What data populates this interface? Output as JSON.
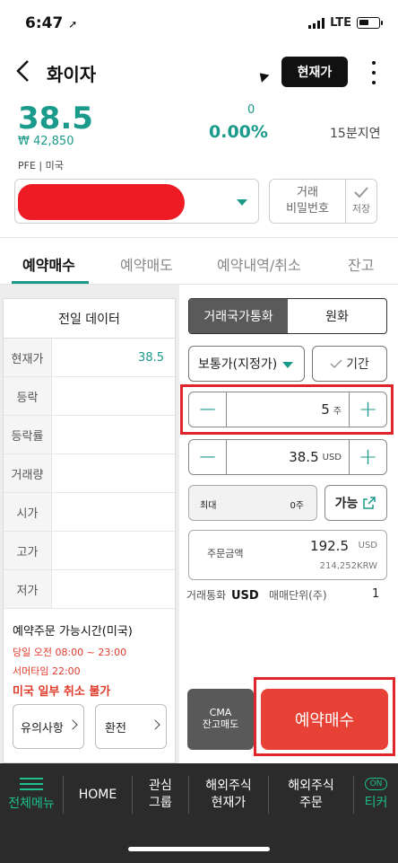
{
  "status": {
    "time": "6:47",
    "network": "LTE"
  },
  "header": {
    "title": "화이자",
    "current_price_button": "현재가"
  },
  "quote": {
    "price": "38.5",
    "krw_price": "₩ 42,850",
    "change": "0",
    "change_pct": "0.00%",
    "delay": "15분지연",
    "ticker": "PFE | 미국"
  },
  "account": {
    "password_label_1": "거래",
    "password_label_2": "비밀번호",
    "save_label": "저장"
  },
  "tabs": [
    "예약매수",
    "예약매도",
    "예약내역/취소",
    "잔고"
  ],
  "prev_day": {
    "title": "전일 데이터",
    "rows": [
      {
        "label": "현재가",
        "value": "38.5"
      },
      {
        "label": "등락",
        "value": ""
      },
      {
        "label": "등락률",
        "value": ""
      },
      {
        "label": "거래량",
        "value": ""
      },
      {
        "label": "시가",
        "value": ""
      },
      {
        "label": "고가",
        "value": ""
      },
      {
        "label": "저가",
        "value": ""
      }
    ]
  },
  "info": {
    "heading": "예약주문 가능시간(미국)",
    "line1": "당일 오전 08:00 ~ 23:00",
    "line2": "서머타임 22:00",
    "warning": "미국 일부 취소 불가",
    "notice_button": "유의사항",
    "exchange_button": "환전"
  },
  "order": {
    "currency_tabs": [
      "거래국가통화",
      "원화"
    ],
    "order_type": "보통가(지정가)",
    "period_label": "기간",
    "quantity": "5",
    "quantity_unit": "주",
    "price": "38.5",
    "price_unit": "USD",
    "max_label": "최대",
    "max_value": "0주",
    "available_label": "가능",
    "amount_label": "주문금액",
    "amount_value": "192.5",
    "amount_unit": "USD",
    "amount_krw": "214,252KRW",
    "currency_label": "거래통화",
    "currency_value": "USD",
    "lot_label": "매매단위(주)",
    "lot_value": "1",
    "cma_line1": "CMA",
    "cma_line2": "잔고매도",
    "buy_button": "예약매수"
  },
  "bottom_nav": {
    "menu": "전체메뉴",
    "home": "HOME",
    "fav_1": "관심",
    "fav_2": "그룹",
    "overseas_price_1": "해외주식",
    "overseas_price_2": "현재가",
    "overseas_order_1": "해외주식",
    "overseas_order_2": "주문",
    "ticker_badge": "ON",
    "ticker": "티커"
  },
  "colors": {
    "accent": "#1a9a8a",
    "buy": "#e84135",
    "highlight": "#e0262c"
  }
}
